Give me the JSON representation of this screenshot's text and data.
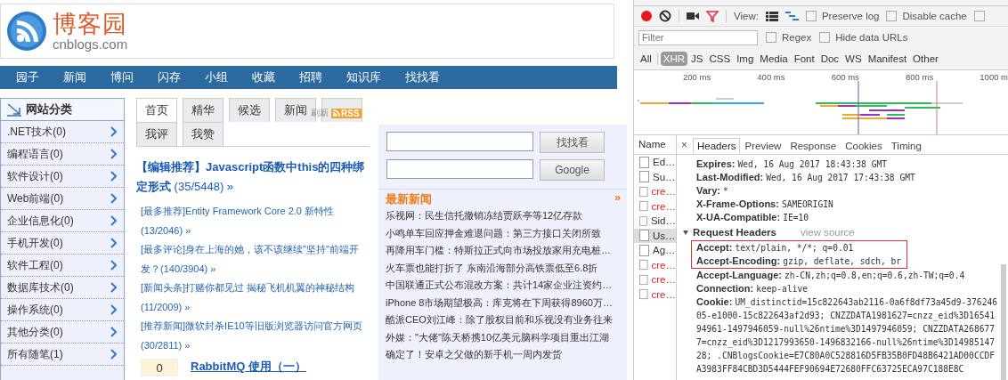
{
  "site": {
    "logo": {
      "title": "博客园",
      "subtitle": "cnblogs.com"
    },
    "nav": [
      "园子",
      "新闻",
      "博问",
      "闪存",
      "小组",
      "收藏",
      "招聘",
      "知识库",
      "找找看"
    ],
    "sidebar": {
      "title": "网站分类",
      "items": [
        ".NET技术(0)",
        "编程语言(0)",
        "软件设计(0)",
        "Web前端(0)",
        "企业信息化(0)",
        "手机开发(0)",
        "软件工程(0)",
        "数据库技术(0)",
        "操作系统(0)",
        "其他分类(0)",
        "所有随笔(1)"
      ]
    },
    "tabs": [
      {
        "label": "首页",
        "selected": true
      },
      {
        "label": "精华",
        "selected": false
      },
      {
        "label": "候选",
        "selected": false
      },
      {
        "label": "新闻",
        "selected": false
      },
      {
        "selected": false
      },
      {
        "label": "我评",
        "selected": false
      },
      {
        "label": "我赞",
        "selected": false
      }
    ],
    "refresh": "刷新",
    "rss": "RSS",
    "featured": {
      "title": "【编辑推荐】Javascript函数中this的四种绑定形式",
      "stats": "(35/5448) »"
    },
    "highlights": [
      {
        "title": "[最多推荐]Entity Framework Core 2.0 新特性",
        "stats": "(13/2046) »"
      },
      {
        "title": "[最多评论]身在上海的她，该不该继续\"坚持\"前端开发？",
        "stats": "(140/3904) »"
      },
      {
        "title": "[新闻头条]打赌你都见过 揭秘飞机机翼的神秘结构",
        "stats": "(11/2009) »"
      },
      {
        "title": "[推荐新闻]微软封杀IE10等旧版浏览器访问官方网页",
        "stats": "(30/2811) »"
      }
    ],
    "post": {
      "diggs": "0",
      "title": "RabbitMQ 使用（一）"
    },
    "search": {
      "buttons": [
        "找找看",
        "Google"
      ]
    },
    "news": {
      "title": "最新新闻",
      "more": "»",
      "items": [
        "乐视网：民生信托撤销冻结贾跃亭等12亿存款",
        "小鸣单车回应押金难退问题：第三方接口关闭所致",
        "再降用车门槛：特斯拉正式向市场投放家用充电桩…",
        "火车票也能打折了 东南沿海部分高铁票低至6.8折",
        "中国联通正式公布混改方案：共计14家企业注资约…",
        "iPhone 8市场期望极高：库克将在下周获得8960万…",
        "酷派CEO刘江峰：除了股权目前和乐视没有业务往来",
        "外媒：\"大佬\"陈天桥携10亿美元脑科学项目重出江湖",
        "确定了！安卓之父做的新手机一周内发货"
      ]
    }
  },
  "devtools": {
    "toolbar": {
      "recording": true,
      "view_label": "View:",
      "checkboxes": [
        {
          "label": "Preserve log",
          "checked": false
        },
        {
          "label": "Disable cache",
          "checked": false
        },
        {
          "checked": false
        }
      ]
    },
    "filter": {
      "placeholder": "Filter",
      "options": [
        {
          "label": "Regex",
          "checked": false
        },
        {
          "label": "Hide data URLs",
          "checked": false
        }
      ]
    },
    "types": [
      {
        "label": "All",
        "selected": false
      },
      {
        "label": "XHR",
        "selected": true
      },
      {
        "label": "JS",
        "selected": false
      },
      {
        "label": "CSS",
        "selected": false
      },
      {
        "label": "Img",
        "selected": false
      },
      {
        "label": "Media",
        "selected": false
      },
      {
        "label": "Font",
        "selected": false
      },
      {
        "label": "Doc",
        "selected": false
      },
      {
        "label": "WS",
        "selected": false
      },
      {
        "label": "Manifest",
        "selected": false
      },
      {
        "label": "Other",
        "selected": false
      }
    ],
    "timeline": {
      "ticks": [
        "200 ms",
        "400 ms",
        "600 ms",
        "800 ms",
        "1000 m"
      ]
    },
    "requests": {
      "header": "Name",
      "items": [
        {
          "name": "Ed…",
          "failed": false,
          "selected": false
        },
        {
          "name": "Su…",
          "failed": false,
          "selected": false
        },
        {
          "name": "cre…",
          "failed": true,
          "selected": false
        },
        {
          "name": "cre…",
          "failed": true,
          "selected": false
        },
        {
          "name": "Sid…",
          "failed": false,
          "selected": false
        },
        {
          "name": "Us…",
          "failed": false,
          "selected": true
        },
        {
          "name": "Ag…",
          "failed": false,
          "selected": false
        },
        {
          "name": "cre…",
          "failed": true,
          "selected": false
        },
        {
          "name": "cre…",
          "failed": true,
          "selected": false
        },
        {
          "name": "cre…",
          "failed": true,
          "selected": false
        }
      ]
    },
    "detail": {
      "close": "×",
      "tabs": [
        {
          "label": "Headers",
          "selected": true
        },
        {
          "label": "Preview",
          "selected": false
        },
        {
          "label": "Response",
          "selected": false
        },
        {
          "label": "Cookies",
          "selected": false
        },
        {
          "label": "Timing",
          "selected": false
        }
      ],
      "response_headers": [
        {
          "name": "Expires:",
          "value": "Wed, 16 Aug 2017 18:43:38 GMT"
        },
        {
          "name": "Last-Modified:",
          "value": "Wed, 16 Aug 2017 17:43:38 GMT"
        },
        {
          "name": "Vary:",
          "value": "*"
        },
        {
          "name": "X-Frame-Options:",
          "value": "SAMEORIGIN"
        },
        {
          "name": "X-UA-Compatible:",
          "value": "IE=10"
        }
      ],
      "request_section": {
        "title": "Request Headers",
        "expanded": true,
        "link": "view source"
      },
      "request_headers": [
        {
          "name": "Accept:",
          "value": "text/plain, */*; q=0.01",
          "highlighted": true
        },
        {
          "name": "Accept-Encoding:",
          "value": "gzip, deflate, sdch, br",
          "highlighted": true
        },
        {
          "name": "Accept-Language:",
          "value": "zh-CN,zh;q=0.8,en;q=0.6,zh-TW;q=0.4",
          "highlighted": false
        },
        {
          "name": "Connection:",
          "value": "keep-alive",
          "highlighted": false
        },
        {
          "name": "Cookie:",
          "value": "UM_distinctid=15c822643ab2116-0a6f8df73a45d9-37624605-e1000-15c822643af2d93; CNZZDATA1981627=cnzz_eid%3D1654194961-1497946059-null%26ntime%3D1497946059; CNZZDATA2686777=cnzz_eid%3D1217993650-1496832166-null%26ntime%3D1498514728; .CNBlogsCookie=E7C80A0C528816D5FB35B0FD48B6421AD00CCDFA3983FF84CBD3D5444FEF90694E72680FFC63725ECA97C188E8C",
          "highlighted": false
        }
      ]
    }
  }
}
